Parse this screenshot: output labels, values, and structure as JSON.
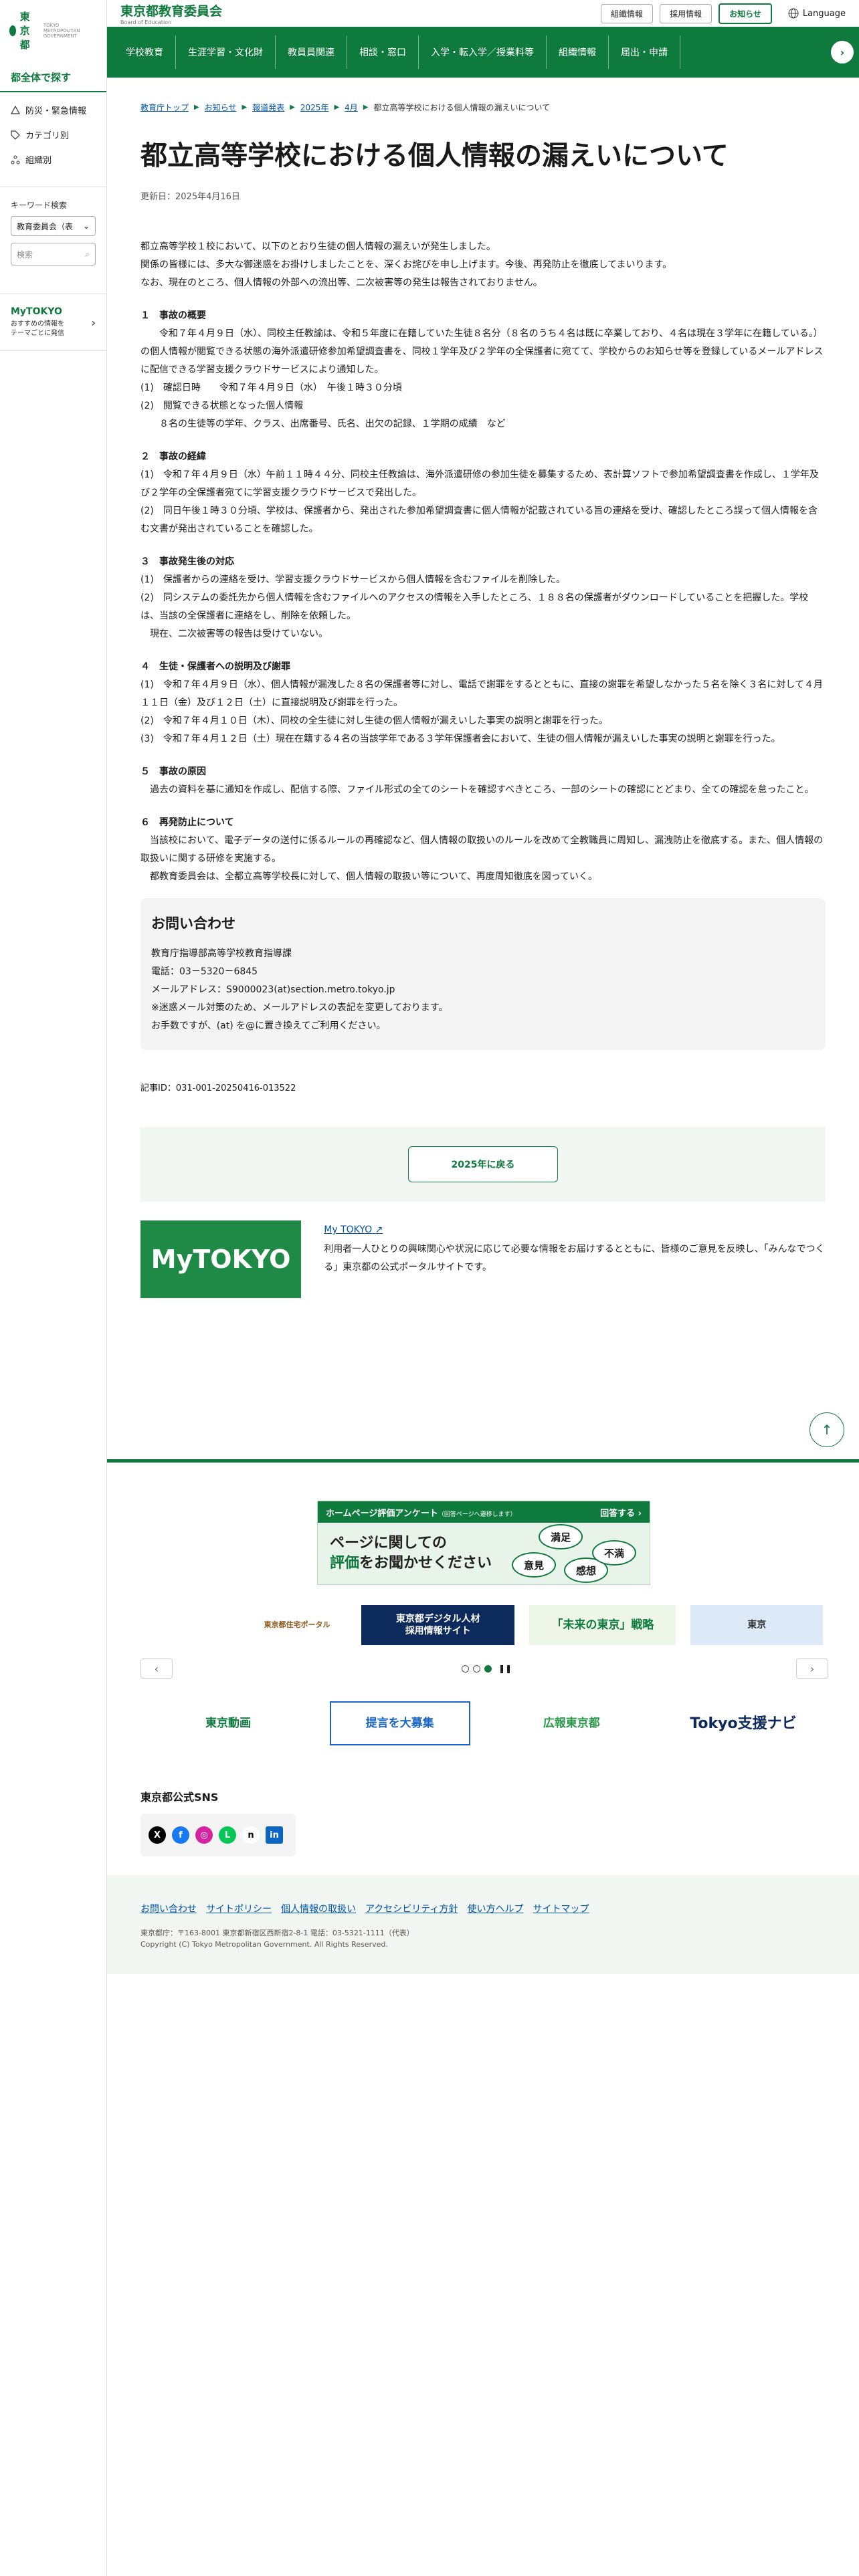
{
  "sidebar": {
    "logo": "東京都",
    "logo_sub": "TOKYO METROPOLITAN GOVERNMENT",
    "heading": "都全体で探す",
    "items": [
      {
        "label": "防災・緊急情報"
      },
      {
        "label": "カテゴリ別"
      },
      {
        "label": "組織別"
      }
    ],
    "keyword_label": "キーワード検索",
    "select_value": "教育委員会（表",
    "search_placeholder": "検索",
    "mytokyo_logo": "MyTOKYO",
    "mytokyo_desc1": "おすすめの情報を",
    "mytokyo_desc2": "テーマごとに発信"
  },
  "header": {
    "title": "東京都教育委員会",
    "subtitle": "Board of Education",
    "links": [
      "組織情報",
      "採用情報",
      "お知らせ"
    ],
    "active_link": "お知らせ",
    "language": "Language"
  },
  "gnav": [
    "学校教育",
    "生涯学習・文化財",
    "教員員関連",
    "相談・窓口",
    "入学・転入学／授業料等",
    "組織情報",
    "届出・申請"
  ],
  "breadcrumb": [
    "教育庁トップ",
    "お知らせ",
    "報道発表",
    "2025年",
    "4月",
    "都立高等学校における個人情報の漏えいについて"
  ],
  "page": {
    "title": "都立高等学校における個人情報の漏えいについて",
    "updated": "更新日：2025年4月16日",
    "intro": [
      "都立高等学校１校において、以下のとおり生徒の個人情報の漏えいが発生しました。",
      "関係の皆様には、多大な御迷惑をお掛けしましたことを、深くお詫びを申し上げます。今後、再発防止を徹底してまいります。",
      "なお、現在のところ、個人情報の外部への流出等、二次被害等の発生は報告されておりません。"
    ],
    "sec1_title": "１　事故の概要",
    "sec1_body": [
      "　　令和７年４月９日（水）、同校主任教諭は、令和５年度に在籍していた生徒８名分（８名のうち４名は既に卒業しており、４名は現在３学年に在籍している。）の個人情報が閲覧できる状態の海外派遣研修参加希望調査書を、同校１学年及び２学年の全保護者に宛てて、学校からのお知らせ等を登録しているメールアドレスに配信できる学習支援クラウドサービスにより通知した。",
      "(1)　確認日時　　令和７年４月９日（水）　午後１時３０分頃",
      "(2)　閲覧できる状態となった個人情報",
      "　　８名の生徒等の学年、クラス、出席番号、氏名、出欠の記録、１学期の成績　など"
    ],
    "sec2_title": "２　事故の経緯",
    "sec2_body": [
      "(1)　令和７年４月９日（水）午前１１時４４分、同校主任教諭は、海外派遣研修の参加生徒を募集するため、表計算ソフトで参加希望調査書を作成し、１学年及び２学年の全保護者宛てに学習支援クラウドサービスで発出した。",
      "(2)　同日午後１時３０分頃、学校は、保護者から、発出された参加希望調査書に個人情報が記載されている旨の連絡を受け、確認したところ誤って個人情報を含む文書が発出されていることを確認した。"
    ],
    "sec3_title": "３　事故発生後の対応",
    "sec3_body": [
      "(1)　保護者からの連絡を受け、学習支援クラウドサービスから個人情報を含むファイルを削除した。",
      "(2)　同システムの委託先から個人情報を含むファイルへのアクセスの情報を入手したところ、１８８名の保護者がダウンロードしていることを把握した。学校は、当該の全保護者に連絡をし、削除を依頼した。",
      "　現在、二次被害等の報告は受けていない。"
    ],
    "sec4_title": "４　生徒・保護者への説明及び謝罪",
    "sec4_body": [
      "(1)　令和７年４月９日（水）、個人情報が漏洩した８名の保護者等に対し、電話で謝罪をするとともに、直接の謝罪を希望しなかった５名を除く３名に対して４月１１日（金）及び１２日（土）に直接説明及び謝罪を行った。",
      "(2)　令和７年４月１０日（木）、同校の全生徒に対し生徒の個人情報が漏えいした事実の説明と謝罪を行った。",
      "(3)　令和７年４月１２日（土）現在在籍する４名の当該学年である３学年保護者会において、生徒の個人情報が漏えいした事実の説明と謝罪を行った。"
    ],
    "sec5_title": "５　事故の原因",
    "sec5_body": [
      "　過去の資料を基に通知を作成し、配信する際、ファイル形式の全てのシートを確認すべきところ、一部のシートの確認にとどまり、全ての確認を怠ったこと。"
    ],
    "sec6_title": "６　再発防止について",
    "sec6_body": [
      "　当該校において、電子データの送付に係るルールの再確認など、個人情報の取扱いのルールを改めて全教職員に周知し、漏洩防止を徹底する。また、個人情報の取扱いに関する研修を実施する。",
      "　都教育委員会は、全都立高等学校長に対して、個人情報の取扱い等について、再度周知徹底を図っていく。"
    ],
    "contact_title": "お問い合わせ",
    "contact_lines": [
      "教育庁指導部高等学校教育指導課",
      "電話：03－5320－6845",
      "メールアドレス：S9000023(at)section.metro.tokyo.jp",
      "※迷惑メール対策のため、メールアドレスの表記を変更しております。",
      "お手数ですが、(at) を@に置き換えてご利用ください。"
    ],
    "article_id": "記事ID：031-001-20250416-013522",
    "back_button": "2025年に戻る"
  },
  "mytokyo": {
    "image_text": "MyTOKYO",
    "link": "My TOKYO",
    "desc": "利用者一人ひとりの興味関心や状況に応じて必要な情報をお届けするとともに、皆様のご意見を反映し、「みんなでつくる」東京都の公式ポータルサイトです。"
  },
  "survey": {
    "header": "ホームページ評価アンケート",
    "header_note": "（回答ページへ遷移します）",
    "answer": "回答する",
    "line1": "ページに関しての",
    "line2a": "評価",
    "line2b": "をお聞かせください",
    "bubbles": [
      "満足",
      "意見",
      "感想",
      "不満"
    ]
  },
  "banners": [
    "東京都住宅ポータル",
    "東京都デジタル人材\n採用情報サイト",
    "「未来の東京」戦略",
    "東京"
  ],
  "banners2": [
    "東京動画",
    "提言を大募集",
    "広報東京都",
    "Tokyo支援ナビ"
  ],
  "sns_heading": "東京都公式SNS",
  "sns": [
    "X",
    "f",
    "◎",
    "L",
    "n",
    "in"
  ],
  "footer": {
    "links": [
      "お問い合わせ",
      "サイトポリシー",
      "個人情報の取扱い",
      "アクセシビリティ方針",
      "使い方ヘルプ",
      "サイトマップ"
    ],
    "address": "東京都庁：〒163-8001 東京都新宿区西新宿2-8-1 電話：03-5321-1111（代表）",
    "copyright": "Copyright (C) Tokyo Metropolitan Government. All Rights Reserved."
  },
  "colors": {
    "brand": "#0f7a3d",
    "link": "#0055aa"
  }
}
